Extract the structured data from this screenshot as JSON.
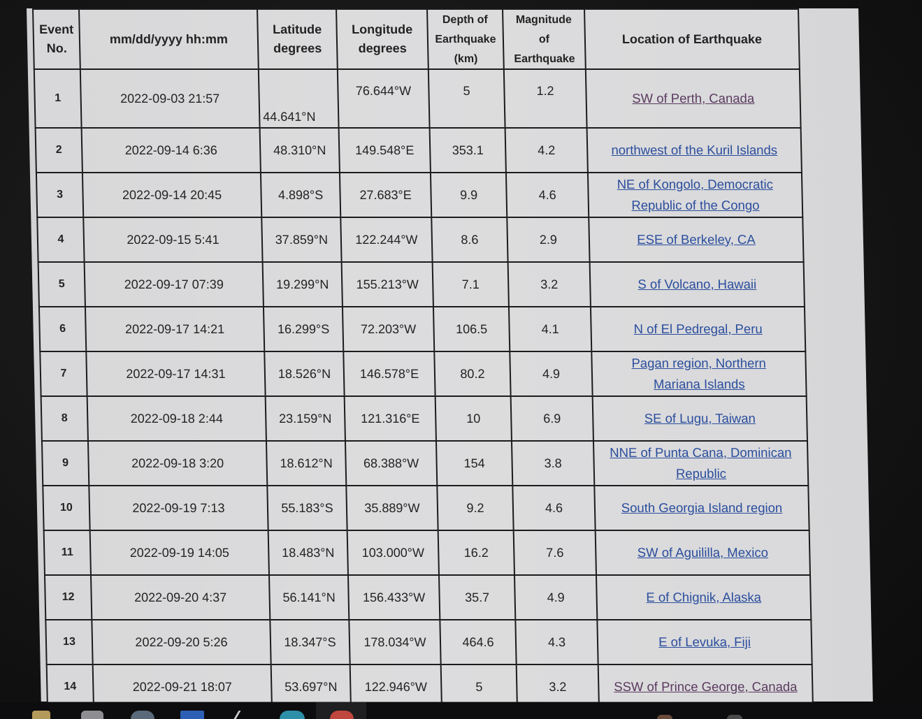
{
  "table": {
    "headers": {
      "event_no_line1": "Event",
      "event_no_line2": "No.",
      "datetime": "mm/dd/yyyy hh:mm",
      "latitude_line1": "Latitude",
      "latitude_line2": "degrees",
      "longitude_line1": "Longitude",
      "longitude_line2": "degrees",
      "depth_line1": "Depth of",
      "depth_line2": "Earthquake",
      "depth_line3": "(km)",
      "magnitude_line1": "Magnitude",
      "magnitude_line2": "of",
      "magnitude_line3": "Earthquake",
      "location": "Location of Earthquake"
    },
    "rows": [
      {
        "no": "1",
        "datetime": "2022-09-03 21:57",
        "lat": "44.641°N",
        "lon": "76.644°W",
        "depth": "5",
        "mag": "1.2",
        "loc_line1": "SW of Perth, Canada",
        "loc_line2": "",
        "visited": true
      },
      {
        "no": "2",
        "datetime": "2022-09-14 6:36",
        "lat": "48.310°N",
        "lon": "149.548°E",
        "depth": "353.1",
        "mag": "4.2",
        "loc_line1": "northwest of the Kuril Islands",
        "loc_line2": "",
        "visited": false
      },
      {
        "no": "3",
        "datetime": "2022-09-14 20:45",
        "lat": "4.898°S",
        "lon": "27.683°E",
        "depth": "9.9",
        "mag": "4.6",
        "loc_line1": "NE of Kongolo, Democratic",
        "loc_line2": "Republic of the Congo",
        "visited": false
      },
      {
        "no": "4",
        "datetime": "2022-09-15 5:41",
        "lat": "37.859°N",
        "lon": "122.244°W",
        "depth": "8.6",
        "mag": "2.9",
        "loc_line1": "ESE of Berkeley, CA",
        "loc_line2": "",
        "visited": false
      },
      {
        "no": "5",
        "datetime": "2022-09-17 07:39",
        "lat": "19.299°N",
        "lon": "155.213°W",
        "depth": "7.1",
        "mag": "3.2",
        "loc_line1": "S of Volcano, Hawaii",
        "loc_line2": "",
        "visited": false
      },
      {
        "no": "6",
        "datetime": "2022-09-17 14:21",
        "lat": "16.299°S",
        "lon": "72.203°W",
        "depth": "106.5",
        "mag": "4.1",
        "loc_line1": "N of El Pedregal, Peru",
        "loc_line2": "",
        "visited": false
      },
      {
        "no": "7",
        "datetime": "2022-09-17 14:31",
        "lat": "18.526°N",
        "lon": "146.578°E",
        "depth": "80.2",
        "mag": "4.9",
        "loc_line1": "Pagan region, Northern",
        "loc_line2": "Mariana Islands",
        "visited": false
      },
      {
        "no": "8",
        "datetime": "2022-09-18 2:44",
        "lat": "23.159°N",
        "lon": "121.316°E",
        "depth": "10",
        "mag": "6.9",
        "loc_line1": "SE of Lugu, Taiwan",
        "loc_line2": "",
        "visited": false
      },
      {
        "no": "9",
        "datetime": "2022-09-18 3:20",
        "lat": "18.612°N",
        "lon": "68.388°W",
        "depth": "154",
        "mag": "3.8",
        "loc_line1": "NNE of Punta Cana, Dominican",
        "loc_line2": "Republic",
        "visited": false
      },
      {
        "no": "10",
        "datetime": "2022-09-19 7:13",
        "lat": "55.183°S",
        "lon": "35.889°W",
        "depth": "9.2",
        "mag": "4.6",
        "loc_line1": "South Georgia Island region",
        "loc_line2": "",
        "visited": false
      },
      {
        "no": "11",
        "datetime": "2022-09-19 14:05",
        "lat": "18.483°N",
        "lon": "103.000°W",
        "depth": "16.2",
        "mag": "7.6",
        "loc_line1": "SW of Aguililla, Mexico",
        "loc_line2": "",
        "visited": false
      },
      {
        "no": "12",
        "datetime": "2022-09-20 4:37",
        "lat": "56.141°N",
        "lon": "156.433°W",
        "depth": "35.7",
        "mag": "4.9",
        "loc_line1": "E of Chignik, Alaska",
        "loc_line2": "",
        "visited": false
      },
      {
        "no": "13",
        "datetime": "2022-09-20 5:26",
        "lat": "18.347°S",
        "lon": "178.034°W",
        "depth": "464.6",
        "mag": "4.3",
        "loc_line1": "E of Levuka, Fiji",
        "loc_line2": "",
        "visited": false
      },
      {
        "no": "14",
        "datetime": "2022-09-21 18:07",
        "lat": "53.697°N",
        "lon": "122.946°W",
        "depth": "5",
        "mag": "3.2",
        "loc_line1": "SSW of Prince George, Canada",
        "loc_line2": "",
        "visited": true
      }
    ]
  },
  "colors": {
    "link": "#2a4d9c",
    "visited_link": "#5a3a5e",
    "grid": "#1c1c1c",
    "page_bg": "#d8d8da"
  },
  "taskbar": {
    "icons": [
      "folder-icon",
      "store-icon",
      "app-icon",
      "app-grid-icon",
      "pen-icon",
      "edge-browser-icon",
      "chrome-browser-icon"
    ]
  }
}
